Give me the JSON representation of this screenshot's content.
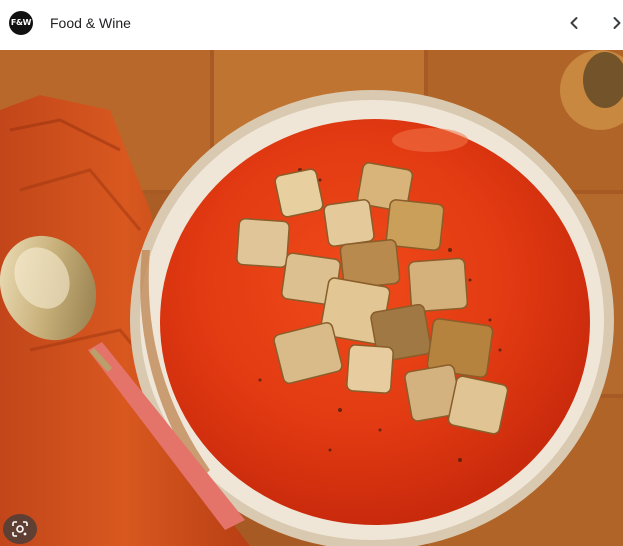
{
  "header": {
    "logo_text": "F&W",
    "site_name": "Food & Wine"
  },
  "nav": {
    "prev_icon": "chevron-left-icon",
    "next_icon": "chevron-right-icon"
  },
  "image": {
    "subject_icon": "tomato-soup-photo"
  },
  "lens": {
    "icon": "google-lens-icon"
  },
  "colors": {
    "header_bg": "#ffffff",
    "title_text": "#202124",
    "soup": "#e23a12",
    "bowl_rim": "#efe6d8",
    "napkin": "#d2541c",
    "tile": "#b8682a"
  }
}
